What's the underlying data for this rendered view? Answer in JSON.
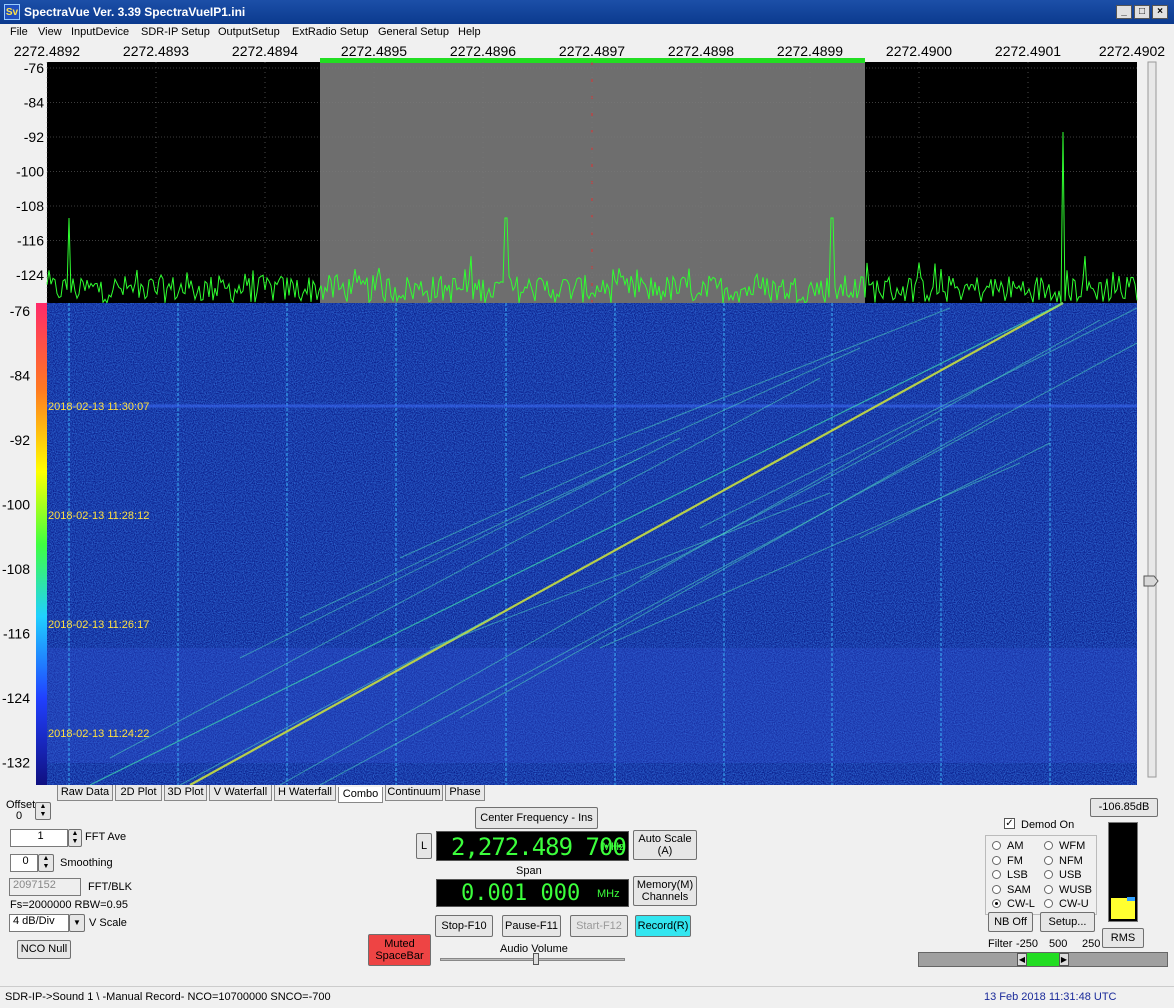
{
  "window": {
    "title": "SpectraVue Ver. 3.39  SpectraVueIP1.ini",
    "logo": "Sv"
  },
  "menu": [
    "File",
    "View",
    "InputDevice",
    "SDR-IP Setup",
    "OutputSetup",
    "ExtRadio Setup",
    "General Setup",
    "Help"
  ],
  "freq_ticks": [
    "2272.4892",
    "2272.4893",
    "2272.4894",
    "2272.4895",
    "2272.4896",
    "2272.4897",
    "2272.4898",
    "2272.4899",
    "2272.4900",
    "2272.4901",
    "2272.4902"
  ],
  "spectrum": {
    "db_ticks": [
      "-76",
      "-84",
      "-92",
      "-100",
      "-108",
      "-116",
      "-124"
    ],
    "filter_highlight": {
      "from_mhz": 2272.48945,
      "to_mhz": 2272.48995
    }
  },
  "waterfall": {
    "db_ticks": [
      "-76",
      "-84",
      "-92",
      "-100",
      "-108",
      "-116",
      "-124",
      "-132"
    ],
    "timestamps": [
      "2018-02-13 11:30:07",
      "2018-02-13 11:28:12",
      "2018-02-13 11:26:17",
      "2018-02-13 11:24:22"
    ]
  },
  "tabs": [
    "Raw Data",
    "2D Plot",
    "3D Plot",
    "V Waterfall",
    "H Waterfall",
    "Combo",
    "Continuum",
    "Phase"
  ],
  "active_tab": "Combo",
  "left_controls": {
    "offset_label": "Offset",
    "offset_value": "0",
    "fft_ave_value": "1",
    "fft_ave_label": "FFT Ave",
    "smoothing_value": "0",
    "smoothing_label": "Smoothing",
    "fft_blk_value": "2097152",
    "fft_blk_label": "FFT/BLK",
    "fs_text": "Fs=2000000 RBW=0.95",
    "vscale_value": "4 dB/Div",
    "vscale_label": "V Scale",
    "nco_null": "NCO Null"
  },
  "center": {
    "center_freq_button": "Center Frequency - Ins",
    "l_button": "L",
    "freq_display": "2,272.489 700",
    "freq_unit": "MHz",
    "auto_scale": "Auto Scale\n(A)",
    "span_label": "Span",
    "span_display": "0.001 000",
    "span_unit": "MHz",
    "memory": "Memory(M)\nChannels",
    "stop": "Stop-F10",
    "pause": "Pause-F11",
    "start": "Start-F12",
    "record": "Record(R)",
    "muted": "Muted\nSpaceBar",
    "audio_volume": "Audio Volume",
    "audio_volume_level": 0.62
  },
  "demod": {
    "level_readout": "-106.85dB",
    "demod_on_label": "Demod On",
    "demod_on": true,
    "modes": [
      {
        "label": "AM",
        "selected": false
      },
      {
        "label": "WFM",
        "selected": false
      },
      {
        "label": "FM",
        "selected": false
      },
      {
        "label": "NFM",
        "selected": false
      },
      {
        "label": "LSB",
        "selected": false
      },
      {
        "label": "USB",
        "selected": false
      },
      {
        "label": "SAM",
        "selected": false
      },
      {
        "label": "WUSB",
        "selected": false
      },
      {
        "label": "CW-L",
        "selected": true
      },
      {
        "label": "CW-U",
        "selected": false
      }
    ],
    "nb_off": "NB Off",
    "setup": "Setup...",
    "rms": "RMS",
    "filter_label": "Filter",
    "filter_values": [
      "-250",
      "500",
      "250"
    ],
    "meter_level": 0.22
  },
  "status": {
    "left": "SDR-IP->Sound 1  \\ -Manual Record-   NCO=10700000  SNCO=-700",
    "right": "13 Feb 2018  11:31:48 UTC"
  },
  "colors": {
    "spectrum_trace": "#30ff30",
    "waterfall_bg": "#0a1e8c",
    "filter_bar": "#22dd22",
    "record_btn": "#33e6f0",
    "muted_btn": "#ee4444"
  }
}
